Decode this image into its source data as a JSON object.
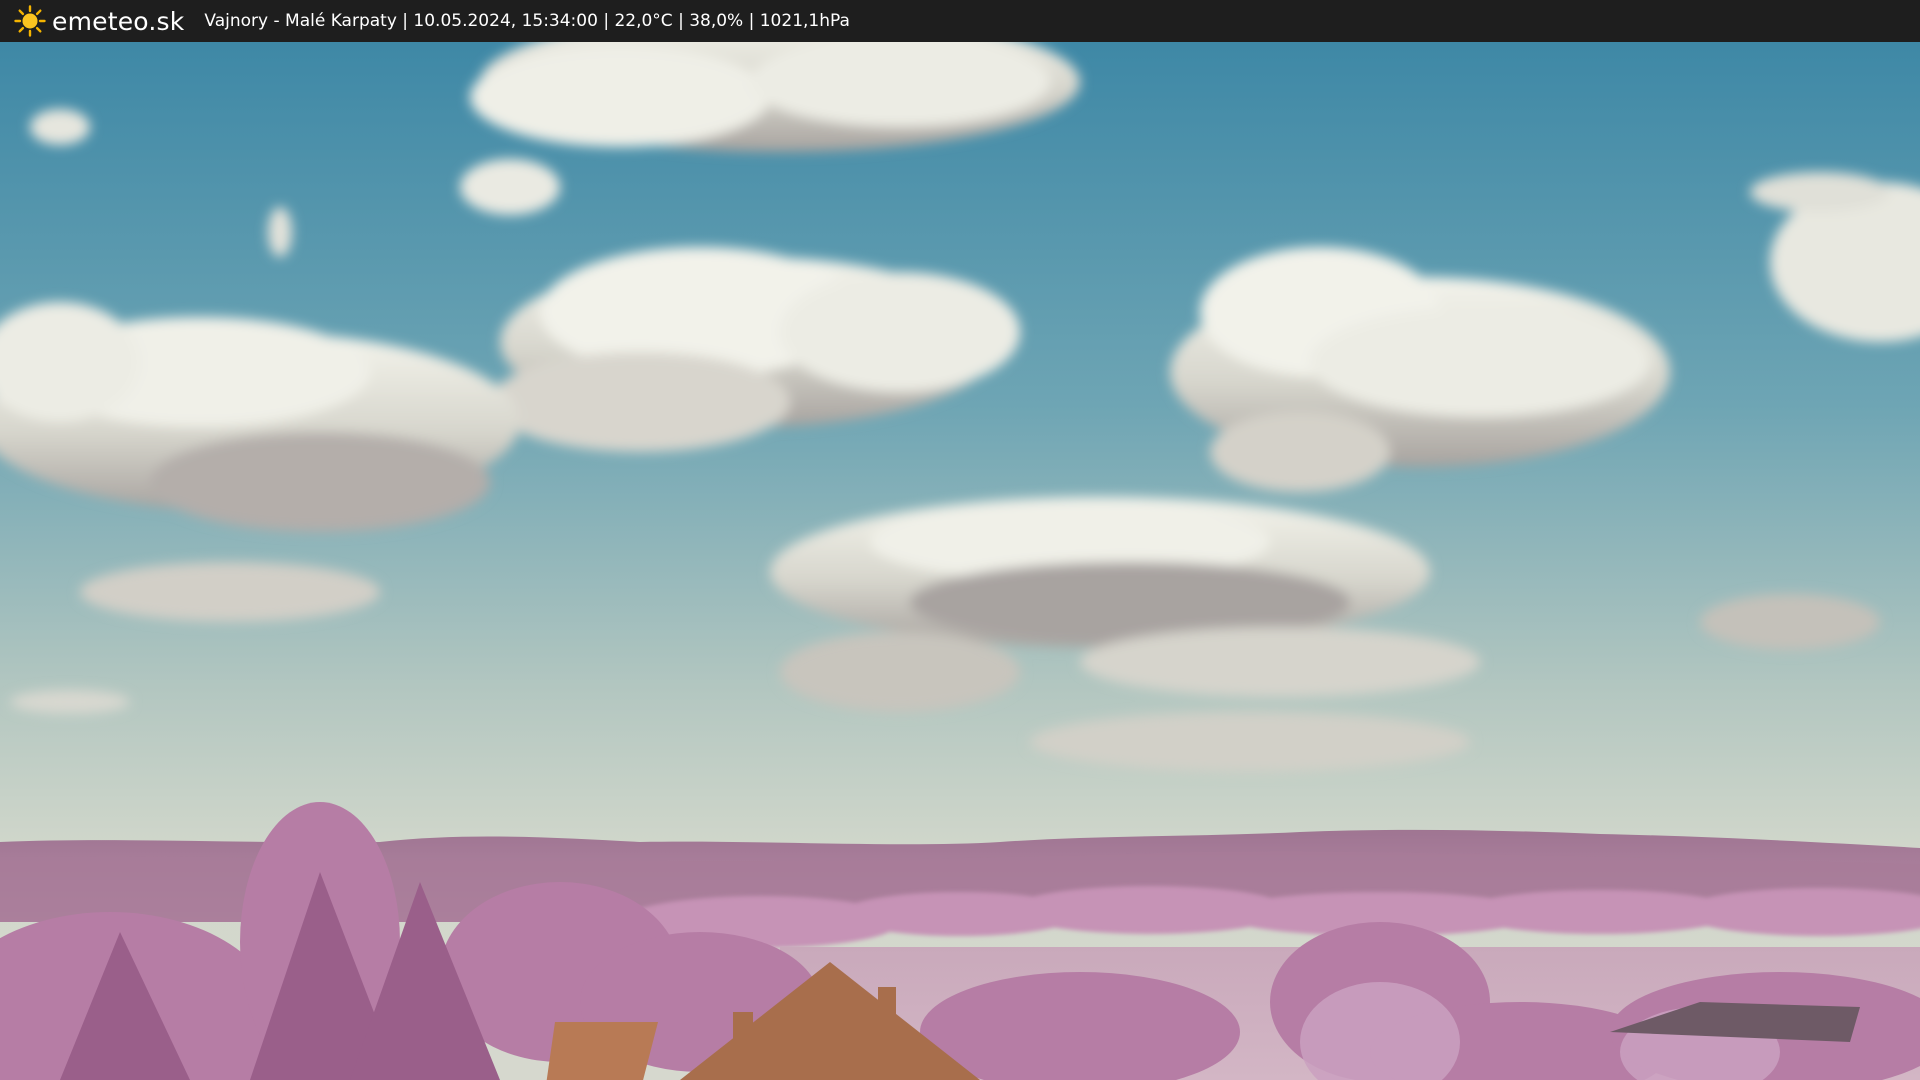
{
  "header": {
    "brand": "emeteo.sk",
    "caption": "Vajnory - Malé Karpaty | 10.05.2024, 15:34:00 | 22,0°C | 38,0% | 1021,1hPa",
    "logo_icon": "sun-icon",
    "background_color": "#1e1e1e",
    "logo_color": "#f5b400"
  },
  "scene": {
    "palette": {
      "sky_top": "#3f8eaa",
      "sky_horizon": "#cfd6cc",
      "hills": "#a77a99",
      "foliage": "#c48cb4",
      "roof": "#b87a55"
    }
  }
}
